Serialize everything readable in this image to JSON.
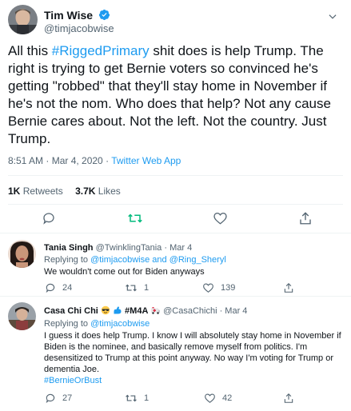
{
  "main_tweet": {
    "author_name": "Tim Wise",
    "handle": "@timjacobwise",
    "text_before_hashtag": "All this ",
    "hashtag": "#RiggedPrimary",
    "text_after_hashtag": " shit does is help Trump. The right is trying to get Bernie voters so convinced he's getting \"robbed\" that they'll stay home in November if he's not the nom. Who does that help? Not any cause Bernie cares about. Not the left. Not the country. Just Trump.",
    "timestamp": "8:51 AM · Mar 4, 2020 · ",
    "source_app": "Twitter Web App",
    "retweets_count": "1K",
    "retweets_label": "Retweets",
    "likes_count": "3.7K",
    "likes_label": "Likes"
  },
  "replies": [
    {
      "author_name": "Tania Singh",
      "handle_date": "@TwinklingTania · Mar 4",
      "replying_prefix": "Replying to ",
      "replying_to": "@timjacobwise and @Ring_Sheryl",
      "text": "We wouldn't come out for Biden anyways",
      "reply_count": "24",
      "retweet_count": "1",
      "like_count": "139"
    },
    {
      "author_name": "Casa Chi Chi",
      "name_tag": "#M4A",
      "handle_date": "@CasaChichi · Mar 4",
      "replying_prefix": "Replying to ",
      "replying_to": "@timjacobwise",
      "text": "I guess it does help Trump. I know I will absolutely stay home in November if Biden is the nominee, and basically remove myself from politics. I'm desensitized to Trump at this point anyway. No way I'm voting for Trump or dementia Joe.",
      "hashtag": "#BernieOrBust",
      "reply_count": "27",
      "retweet_count": "1",
      "like_count": "42"
    }
  ],
  "colors": {
    "accent": "#1d9bf0",
    "retweet_green": "#00ba7c",
    "secondary_text": "#536471",
    "divider": "#eff3f4"
  },
  "icons": [
    "verified-badge-icon",
    "chevron-down-icon",
    "reply-icon",
    "retweet-icon",
    "like-icon",
    "share-icon",
    "sunglasses-emoji-icon",
    "flexed-biceps-emoji-icon",
    "ambulance-emoji-icon"
  ]
}
